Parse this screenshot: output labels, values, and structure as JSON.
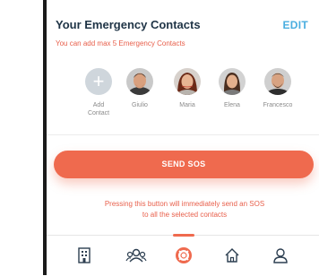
{
  "header": {
    "title": "Your Emergency Contacts",
    "edit_label": "EDIT",
    "subtitle": "You can add max 5 Emergency Contacts"
  },
  "contacts": {
    "add": {
      "label_line1": "Add",
      "label_line2": "Contact"
    },
    "people": [
      {
        "name": "Giulio"
      },
      {
        "name": "Maria"
      },
      {
        "name": "Elena"
      },
      {
        "name": "Francesco"
      }
    ]
  },
  "sos": {
    "button_label": "SEND SOS",
    "note_line1": "Pressing this button will immediately send an SOS",
    "note_line2": "to all the selected contacts"
  },
  "tabbar": {
    "items": [
      {
        "icon": "building-icon"
      },
      {
        "icon": "group-icon"
      },
      {
        "icon": "lifebuoy-icon",
        "active": true
      },
      {
        "icon": "home-icon"
      },
      {
        "icon": "user-icon"
      }
    ]
  },
  "colors": {
    "accent": "#ef6a4e",
    "link": "#4aaee0",
    "title": "#1f3446"
  }
}
